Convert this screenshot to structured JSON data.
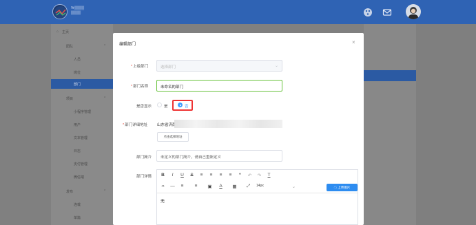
{
  "header": {
    "logo_line1": "Vr▒▒▒▒",
    "logo_line2": "▒▒▒▒"
  },
  "sidebar": {
    "home": "主页",
    "groups": [
      {
        "label": "团队",
        "items": [
          "人员",
          "岗位",
          "部门"
        ]
      },
      {
        "label": "项目",
        "items": [
          "小程序管理",
          "用户",
          "文本管理",
          "日志",
          "支付管理",
          "微信端"
        ]
      },
      {
        "label": "发布",
        "items": [
          "连载",
          "单篇"
        ]
      }
    ],
    "active_item": "部门"
  },
  "modal": {
    "title": "编辑部门",
    "close": "×",
    "parent_label": "上级部门",
    "parent_value": "选择部门",
    "name_label": "部门名称",
    "name_value": "未命名的部门",
    "show_label": "是否显示",
    "show_yes": "是",
    "show_no": "否",
    "show_selected": "否",
    "address_label": "部门详细地址",
    "address_value": "山东省济南市",
    "address_button": "点击选择地址",
    "intro_label": "部门简介",
    "intro_placeholder": "未定义的部门简介，请自己重新定义",
    "detail_label": "部门详情",
    "editor_font_size": "14px",
    "upload_button": "上传图片",
    "editor_content": "无"
  },
  "colors": {
    "topbar": "#2f63b4",
    "active": "#2b5aa3",
    "required": "#e74c3c",
    "radio_checked": "#409eff",
    "highlight_box": "#ee3333",
    "upload": "#2d8cf0"
  }
}
